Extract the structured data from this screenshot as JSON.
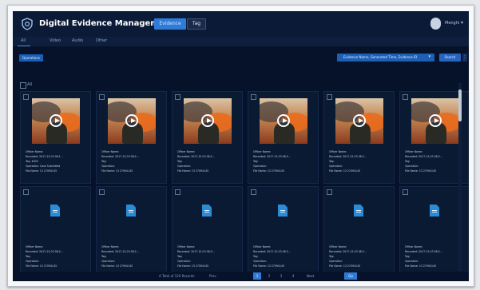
{
  "header": {
    "title": "Digital Evidence Management",
    "tabs": [
      {
        "label": "Evidence"
      },
      {
        "label": "Tag"
      }
    ],
    "user": "Menghi"
  },
  "menu": {
    "items": [
      "All",
      "Video",
      "Audio",
      "Other"
    ]
  },
  "toolbar": {
    "left_button": "Operations",
    "dropdown_value": "Evidence Name, Generated Time, Evidence ID",
    "right_button": "Search"
  },
  "select_all_label": "All",
  "cards": [
    {
      "type": "video",
      "lines": [
        "Officer Name:",
        "Recorded: 2017-12-03 08:1...",
        "Tag: 4000",
        "Operation: Case Submitted",
        "File Name: 13 27094145"
      ]
    },
    {
      "type": "video",
      "lines": [
        "Officer Name:",
        "Recorded: 2017-12-03 08:2...",
        "Tag:",
        "Operation:",
        "File Name: 13 27094145"
      ]
    },
    {
      "type": "video",
      "lines": [
        "Officer Name:",
        "Recorded: 2017-12-03 08:2...",
        "Tag:",
        "Operation:",
        "File Name: 13 27094145"
      ]
    },
    {
      "type": "video",
      "lines": [
        "Officer Name:",
        "Recorded: 2017-12-03 08:2...",
        "Tag:",
        "Operation:",
        "File Name: 13 27094145"
      ]
    },
    {
      "type": "video",
      "lines": [
        "Officer Name:",
        "Recorded: 2017-12-03 08:2...",
        "Tag:",
        "Operation:",
        "File Name: 13 27094145"
      ]
    },
    {
      "type": "video",
      "lines": [
        "Officer Name:",
        "Recorded: 2017-12-03 08:2...",
        "Tag:",
        "Operation:",
        "File Name: 13 27094145"
      ]
    },
    {
      "type": "document",
      "lines": [
        "Officer Name:",
        "Recorded: 2017-12-03 08:2...",
        "Tag:",
        "Operation:",
        "File Name: 13 27094145"
      ]
    },
    {
      "type": "document",
      "lines": [
        "Officer Name:",
        "Recorded: 2017-12-03 08:2...",
        "Tag:",
        "Operation:",
        "File Name: 13 27094145"
      ]
    },
    {
      "type": "document",
      "lines": [
        "Officer Name:",
        "Recorded: 2017-12-03 08:2...",
        "Tag:",
        "Operation:",
        "File Name: 13 27094145"
      ]
    },
    {
      "type": "document",
      "lines": [
        "Officer Name:",
        "Recorded: 2017-12-03 08:2...",
        "Tag:",
        "Operation:",
        "File Name: 13 27094145"
      ]
    },
    {
      "type": "document",
      "lines": [
        "Officer Name:",
        "Recorded: 2017-12-03 08:2...",
        "Tag:",
        "Operation:",
        "File Name: 13 27094145"
      ]
    },
    {
      "type": "document",
      "lines": [
        "Officer Name:",
        "Recorded: 2017-12-03 08:2...",
        "Tag:",
        "Operation:",
        "File Name: 13 27094145"
      ]
    }
  ],
  "pager": {
    "total_text": "A Total of 120 Records",
    "prev": "Prev",
    "pages": [
      "1",
      "2",
      "3",
      "4"
    ],
    "active_page": "1",
    "next": "Next",
    "goto": "Go"
  }
}
